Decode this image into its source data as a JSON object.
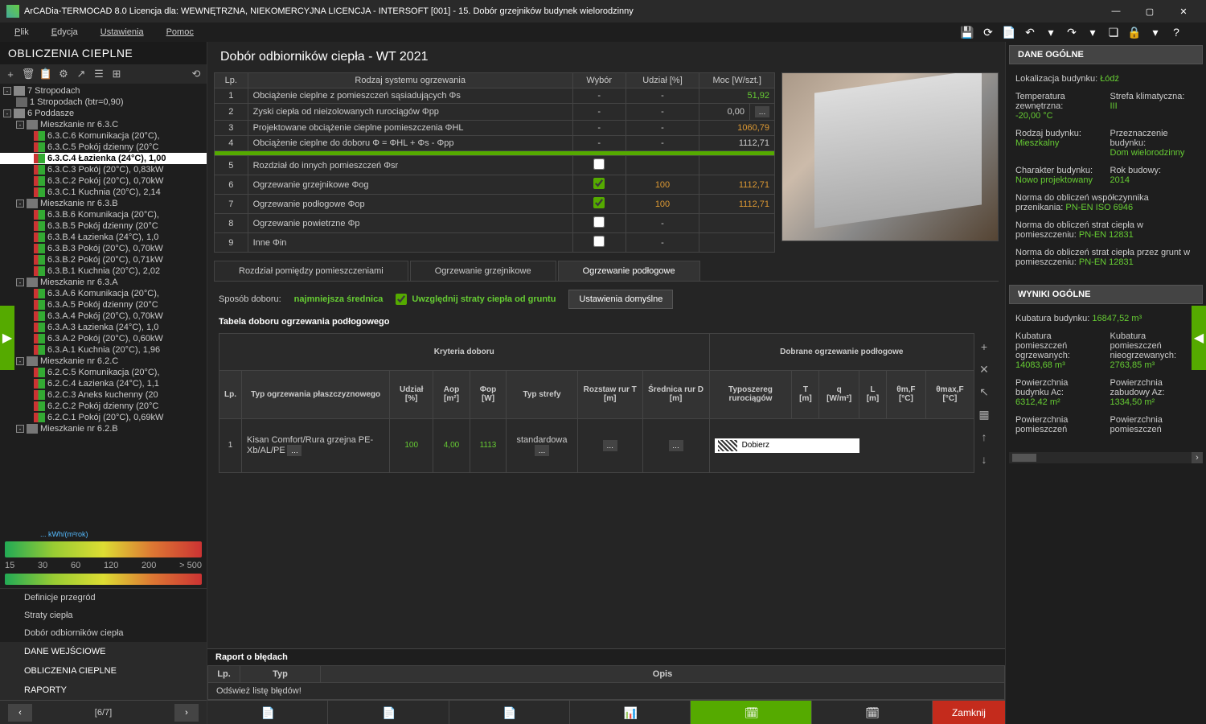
{
  "titlebar": "ArCADia-TERMOCAD 8.0 Licencja dla: WEWNĘTRZNA, NIEKOMERCYJNA LICENCJA - INTERSOFT [001] - 15. Dobór grzejników budynek wielorodzinny",
  "menu": {
    "plik": "Plik",
    "edycja": "Edycja",
    "ustawienia": "Ustawienia",
    "pomoc": "Pomoc"
  },
  "leftPanel": {
    "title": "OBLICZENIA CIEPLNE",
    "tree": [
      {
        "l": 0,
        "exp": "-",
        "icon": "building",
        "t": "7 Stropodach"
      },
      {
        "l": 1,
        "exp": "",
        "icon": "floor",
        "t": "1 Stropodach (btr=0,90)"
      },
      {
        "l": 0,
        "exp": "-",
        "icon": "building",
        "t": "6 Poddasze"
      },
      {
        "l": 1,
        "exp": "-",
        "icon": "apt",
        "t": "Mieszkanie nr 6.3.C"
      },
      {
        "l": 2,
        "exp": "",
        "icon": "room",
        "t": "6.3.C.6 Komunikacja (20°C),"
      },
      {
        "l": 2,
        "exp": "",
        "icon": "room",
        "t": "6.3.C.5 Pokój dzienny (20°C"
      },
      {
        "l": 2,
        "exp": "",
        "icon": "room",
        "t": "6.3.C.4 Łazienka (24°C), 1,00",
        "sel": true
      },
      {
        "l": 2,
        "exp": "",
        "icon": "room",
        "t": "6.3.C.3 Pokój (20°C), 0,83kW"
      },
      {
        "l": 2,
        "exp": "",
        "icon": "room",
        "t": "6.3.C.2 Pokój (20°C), 0,70kW"
      },
      {
        "l": 2,
        "exp": "",
        "icon": "room",
        "t": "6.3.C.1 Kuchnia (20°C), 2,14"
      },
      {
        "l": 1,
        "exp": "-",
        "icon": "apt",
        "t": "Mieszkanie nr 6.3.B"
      },
      {
        "l": 2,
        "exp": "",
        "icon": "room",
        "t": "6.3.B.6 Komunikacja (20°C),"
      },
      {
        "l": 2,
        "exp": "",
        "icon": "room",
        "t": "6.3.B.5 Pokój dzienny (20°C"
      },
      {
        "l": 2,
        "exp": "",
        "icon": "room",
        "t": "6.3.B.4 Łazienka (24°C), 1,0"
      },
      {
        "l": 2,
        "exp": "",
        "icon": "room",
        "t": "6.3.B.3 Pokój (20°C), 0,70kW"
      },
      {
        "l": 2,
        "exp": "",
        "icon": "room",
        "t": "6.3.B.2 Pokój (20°C), 0,71kW"
      },
      {
        "l": 2,
        "exp": "",
        "icon": "room",
        "t": "6.3.B.1 Kuchnia (20°C), 2,02"
      },
      {
        "l": 1,
        "exp": "-",
        "icon": "apt",
        "t": "Mieszkanie nr 6.3.A"
      },
      {
        "l": 2,
        "exp": "",
        "icon": "room",
        "t": "6.3.A.6 Komunikacja (20°C),"
      },
      {
        "l": 2,
        "exp": "",
        "icon": "room",
        "t": "6.3.A.5 Pokój dzienny (20°C"
      },
      {
        "l": 2,
        "exp": "",
        "icon": "room",
        "t": "6.3.A.4 Pokój (20°C), 0,70kW"
      },
      {
        "l": 2,
        "exp": "",
        "icon": "room",
        "t": "6.3.A.3 Łazienka (24°C), 1,0"
      },
      {
        "l": 2,
        "exp": "",
        "icon": "room",
        "t": "6.3.A.2 Pokój (20°C), 0,60kW"
      },
      {
        "l": 2,
        "exp": "",
        "icon": "room",
        "t": "6.3.A.1 Kuchnia (20°C), 1,96"
      },
      {
        "l": 1,
        "exp": "-",
        "icon": "apt",
        "t": "Mieszkanie nr 6.2.C"
      },
      {
        "l": 2,
        "exp": "",
        "icon": "room",
        "t": "6.2.C.5 Komunikacja (20°C),"
      },
      {
        "l": 2,
        "exp": "",
        "icon": "room",
        "t": "6.2.C.4 Łazienka (24°C), 1,1"
      },
      {
        "l": 2,
        "exp": "",
        "icon": "room",
        "t": "6.2.C.3 Aneks kuchenny (20"
      },
      {
        "l": 2,
        "exp": "",
        "icon": "room",
        "t": "6.2.C.2 Pokój dzienny (20°C"
      },
      {
        "l": 2,
        "exp": "",
        "icon": "room",
        "t": "6.2.C.1 Pokój (20°C), 0,69kW"
      },
      {
        "l": 1,
        "exp": "-",
        "icon": "apt",
        "t": "Mieszkanie nr 6.2.B"
      }
    ],
    "energyLabel": "... kWh/(m²rok)",
    "scale": [
      "15",
      "30",
      "60",
      "120",
      "200",
      "> 500"
    ],
    "sections": [
      "Definicje przegród",
      "Straty ciepła",
      "Dobór odbiorników ciepła"
    ],
    "headers": [
      "DANE WEJŚCIOWE",
      "OBLICZENIA CIEPLNE",
      "RAPORTY"
    ],
    "pager": "[6/7]"
  },
  "content": {
    "title": "Dobór odbiorników ciepła - WT 2021",
    "headers": {
      "lp": "Lp.",
      "rodzaj": "Rodzaj systemu ogrzewania",
      "wybor": "Wybór",
      "udzial": "Udział [%]",
      "moc": "Moc [W/szt.]"
    },
    "rows": [
      {
        "lp": "1",
        "n": "Obciążenie cieplne z pomieszczeń sąsiadujących Φs",
        "w": "-",
        "u": "-",
        "m": "51,92",
        "cls": "val-green"
      },
      {
        "lp": "2",
        "n": "Zyski ciepła od nieizolowanych rurociągów Φpp",
        "w": "-",
        "u": "-",
        "m": "0,00",
        "edit": true,
        "cls": ""
      },
      {
        "lp": "3",
        "n": "Projektowane obciążenie cieplne pomieszczenia ΦHL",
        "w": "-",
        "u": "-",
        "m": "1060,79",
        "cls": "val-orange"
      },
      {
        "lp": "4",
        "n": "Obciążenie cieplne do doboru Φ = ΦHL + Φs - Φpp",
        "w": "-",
        "u": "-",
        "m": "1112,71",
        "cls": ""
      }
    ],
    "rows2": [
      {
        "lp": "5",
        "n": "Rozdział do innych pomieszczeń Φsr",
        "w": "chk0",
        "u": "",
        "m": ""
      },
      {
        "lp": "6",
        "n": "Ogrzewanie grzejnikowe Φog",
        "w": "chk1",
        "u": "100",
        "m": "1112,71",
        "cls": "val-orange"
      },
      {
        "lp": "7",
        "n": "Ogrzewanie podłogowe Φop",
        "w": "chk1",
        "u": "100",
        "m": "1112,71",
        "cls": "val-orange"
      },
      {
        "lp": "8",
        "n": "Ogrzewanie powietrzne Φp",
        "w": "chk0",
        "u": "-",
        "m": ""
      },
      {
        "lp": "9",
        "n": "Inne Φin",
        "w": "chk0",
        "u": "-",
        "m": ""
      }
    ],
    "tabs": [
      "Rozdział pomiędzy pomieszczeniami",
      "Ogrzewanie grzejnikowe",
      "Ogrzewanie podłogowe"
    ],
    "form": {
      "sposobLabel": "Sposób doboru:",
      "sposob": "najmniejsza średnica",
      "chkLabel": "Uwzględnij straty ciepła od gruntu",
      "btnDefault": "Ustawienia domyślne",
      "tableTitle": "Tabela doboru ogrzewania podłogowego",
      "kryteria": "Kryteria doboru",
      "dobrane": "Dobrane ogrzewanie podłogowe"
    },
    "crit": {
      "h": [
        "Lp.",
        "Typ ogrzewania płaszczyznowego",
        "Udział [%]",
        "Aop [m²]",
        "Φop [W]",
        "Typ strefy",
        "Rozstaw rur T [m]",
        "Średnica rur D [m]",
        "Typoszereg rurociągów",
        "T [m]",
        "q [W/m²]",
        "L [m]",
        "θm,F [°C]",
        "θmax,F [°C]"
      ],
      "r": {
        "lp": "1",
        "typ": "Kisan Comfort/Rura grzejna PE-Xb/AL/PE",
        "u": "100",
        "a": "4,00",
        "f": "1113",
        "strefa": "standardowa",
        "pipe": "Dobierz"
      }
    },
    "report": {
      "title": "Raport o błędach",
      "h": [
        "Lp.",
        "Typ",
        "Opis"
      ],
      "msg": "Odśwież listę błędów!"
    }
  },
  "right": {
    "h1": "DANE OGÓLNE",
    "loc": {
      "l": "Lokalizacja budynku:",
      "v": "Łódź"
    },
    "temp": {
      "l": "Temperatura zewnętrzna:",
      "v": "-20,00 °C"
    },
    "strefa": {
      "l": "Strefa klimatyczna:",
      "v": "III"
    },
    "rodzaj": {
      "l": "Rodzaj budynku:",
      "v": "Mieszkalny"
    },
    "przeznaczenie": {
      "l": "Przeznaczenie budynku:",
      "v": "Dom wielorodzinny"
    },
    "charakter": {
      "l": "Charakter budynku:",
      "v": "Nowo projektowany"
    },
    "rok": {
      "l": "Rok budowy:",
      "v": "2014"
    },
    "norma1": {
      "l": "Norma do obliczeń współczynnika przenikania:",
      "v": "PN-EN ISO 6946"
    },
    "norma2": {
      "l": "Norma do obliczeń strat ciepła w pomieszczeniu:",
      "v": "PN-EN 12831"
    },
    "norma3": {
      "l": "Norma do obliczeń strat ciepła przez grunt w pomieszczeniu:",
      "v": "PN-EN 12831"
    },
    "h2": "WYNIKI OGÓLNE",
    "kub": {
      "l": "Kubatura budynku:",
      "v": "16847,52 m³"
    },
    "kubOgrz": {
      "l": "Kubatura pomieszczeń ogrzewanych:",
      "v": "14083,68 m³"
    },
    "kubNieogrz": {
      "l": "Kubatura pomieszczeń nieogrzewanych:",
      "v": "2763,85 m³"
    },
    "powAc": {
      "l": "Powierzchnia budynku Ac:",
      "v": "6312,42 m²"
    },
    "powAz": {
      "l": "Powierzchnia zabudowy Az:",
      "v": "1334,50 m²"
    },
    "pow1": {
      "l": "Powierzchnia pomieszczeń"
    },
    "pow2": {
      "l": "Powierzchnia pomieszczeń"
    }
  },
  "closeBtn": "Zamknij"
}
